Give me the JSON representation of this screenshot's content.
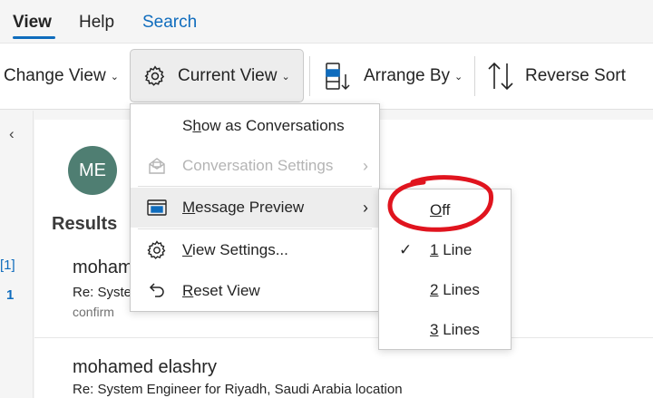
{
  "menubar": {
    "view": "View",
    "help": "Help",
    "search": "Search"
  },
  "ribbon": {
    "change_view": "Change View",
    "current_view": "Current View",
    "arrange_by": "Arrange By",
    "reverse_sort": "Reverse Sort"
  },
  "menu": {
    "show_conversations": {
      "pre": "S",
      "u": "h",
      "post": "ow as Conversations"
    },
    "conversation_settings": "Conversation Settings",
    "message_preview": {
      "u": "M",
      "post": "essage Preview"
    },
    "view_settings": {
      "u": "V",
      "post": "iew Settings..."
    },
    "reset_view": {
      "u": "R",
      "post": "eset View"
    }
  },
  "submenu": {
    "off": {
      "u": "O",
      "post": "ff"
    },
    "one_line": {
      "u": "1",
      "post": " Line"
    },
    "two_lines": {
      "u": "2",
      "post": " Lines"
    },
    "three_lines": {
      "u": "3",
      "post": " Lines"
    }
  },
  "content": {
    "avatar_initials": "ME",
    "results_label": "Results",
    "item1": {
      "sender": "mohamed elashry",
      "subject": "Re: System Engineer for Riyadh, Saudi Arabia location",
      "preview": "confirm"
    },
    "item2": {
      "sender": "mohamed elashry",
      "subject": "Re: System Engineer for Riyadh, Saudi Arabia location"
    },
    "left_numbers": [
      "[1]",
      "1"
    ]
  },
  "colors": {
    "accent": "#0f6cbd",
    "avatar": "#4f7e72",
    "annotation": "#e0141e"
  },
  "icons": [
    "gear-icon",
    "chevron-down-icon",
    "arrange-icon",
    "sort-icon",
    "chat-settings-icon",
    "preview-icon",
    "reset-icon",
    "checkmark-icon",
    "chevron-right-icon",
    "collapse-icon"
  ]
}
